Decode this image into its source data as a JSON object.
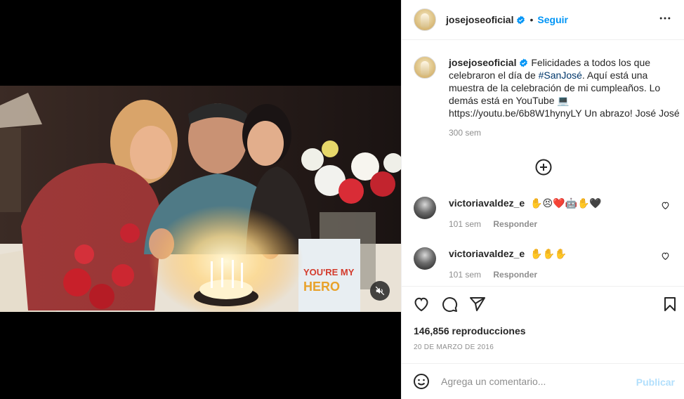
{
  "post": {
    "username": "josejoseoficial",
    "follow_label": "Seguir",
    "separator": "•"
  },
  "caption": {
    "username": "josejoseoficial",
    "text_before": " Felicidades a todos los que celebraron el día de ",
    "hashtag": "#SanJosé",
    "text_after": ". Aquí está una muestra de la celebración de mi cumpleaños. Lo demás está en YouTube 💻 https://youtu.be/6b8W1hynyLY Un abrazo! José José",
    "time": "300 sem"
  },
  "comments": [
    {
      "username": "victoriavaldez_e",
      "text": "✋😣❤️🤖✋🖤",
      "time": "101 sem",
      "reply_label": "Responder"
    },
    {
      "username": "victoriavaldez_e",
      "text": "✋✋✋",
      "time": "101 sem",
      "reply_label": "Responder"
    }
  ],
  "stats": {
    "views": "146,856 reproducciones",
    "date": "20 DE MARZO DE 2016"
  },
  "add_comment": {
    "placeholder": "Agrega un comentario...",
    "publish_label": "Publicar"
  },
  "icons": {
    "verified": "verified-badge-icon",
    "more": "more-options-icon",
    "load_more": "plus-circle-icon",
    "like": "heart-icon",
    "comment": "comment-icon",
    "share": "paper-plane-icon",
    "save": "bookmark-icon",
    "emoji": "emoji-icon",
    "mute": "speaker-muted-icon"
  },
  "colors": {
    "link_blue": "#0095f6",
    "publish_disabled": "#b2dffc",
    "hashtag": "#00376b",
    "muted_text": "#8e8e8e"
  }
}
